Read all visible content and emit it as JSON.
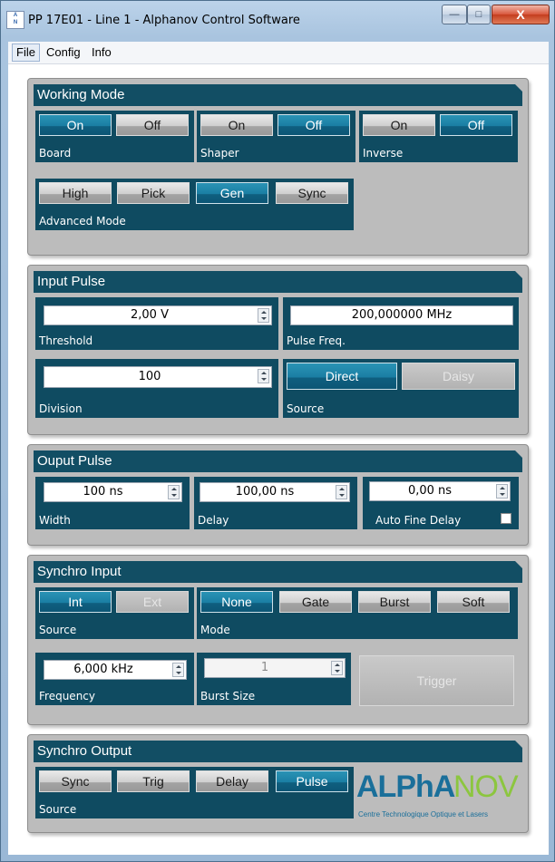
{
  "window": {
    "title": "PP 17E01 - Line 1 - Alphanov Control Software",
    "app_icon_text": "ALPhA NOV",
    "minimize_glyph": "—",
    "maximize_glyph": "□",
    "close_glyph": "X"
  },
  "menu": {
    "file": "File",
    "config": "Config",
    "info": "Info"
  },
  "working_mode": {
    "title": "Working Mode",
    "board": {
      "label": "Board",
      "on": "On",
      "off": "Off",
      "selected": "On"
    },
    "shaper": {
      "label": "Shaper",
      "on": "On",
      "off": "Off",
      "selected": "Off"
    },
    "inverse": {
      "label": "Inverse",
      "on": "On",
      "off": "Off",
      "selected": "Off"
    },
    "advanced": {
      "label": "Advanced Mode",
      "high": "High",
      "pick": "Pick",
      "gen": "Gen",
      "sync": "Sync",
      "selected": "Gen"
    }
  },
  "input_pulse": {
    "title": "Input Pulse",
    "threshold": {
      "label": "Threshold",
      "value": "2,00 V"
    },
    "pulse_freq": {
      "label": "Pulse Freq.",
      "value": "200,000000 MHz"
    },
    "division": {
      "label": "Division",
      "value": "100"
    },
    "source": {
      "label": "Source",
      "direct": "Direct",
      "daisy": "Daisy",
      "selected": "Direct"
    }
  },
  "output_pulse": {
    "title": "Ouput Pulse",
    "width": {
      "label": "Width",
      "value": "100 ns"
    },
    "delay": {
      "label": "Delay",
      "value": "100,00 ns"
    },
    "auto_fine_delay": {
      "label": "Auto Fine Delay",
      "value": "0,00 ns",
      "checked": false
    }
  },
  "synchro_input": {
    "title": "Synchro Input",
    "source": {
      "label": "Source",
      "int": "Int",
      "ext": "Ext",
      "selected": "Int"
    },
    "mode": {
      "label": "Mode",
      "none": "None",
      "gate": "Gate",
      "burst": "Burst",
      "soft": "Soft",
      "selected": "None"
    },
    "frequency": {
      "label": "Frequency",
      "value": "6,000 kHz"
    },
    "burst_size": {
      "label": "Burst Size",
      "value": "1"
    },
    "trigger": "Trigger"
  },
  "synchro_output": {
    "title": "Synchro Output",
    "source": {
      "label": "Source",
      "sync": "Sync",
      "trig": "Trig",
      "delay": "Delay",
      "pulse": "Pulse",
      "selected": "Pulse"
    }
  },
  "logo": {
    "alpha": "ALPhA",
    "nov": "NOV",
    "tagline": "Centre Technologique Optique et Lasers"
  },
  "colors": {
    "accent": "#124e64",
    "button_on": "#1a7ea3",
    "panel": "#bcbcbc",
    "logo_blue": "#1a6f9a",
    "logo_green": "#8cc63f"
  }
}
